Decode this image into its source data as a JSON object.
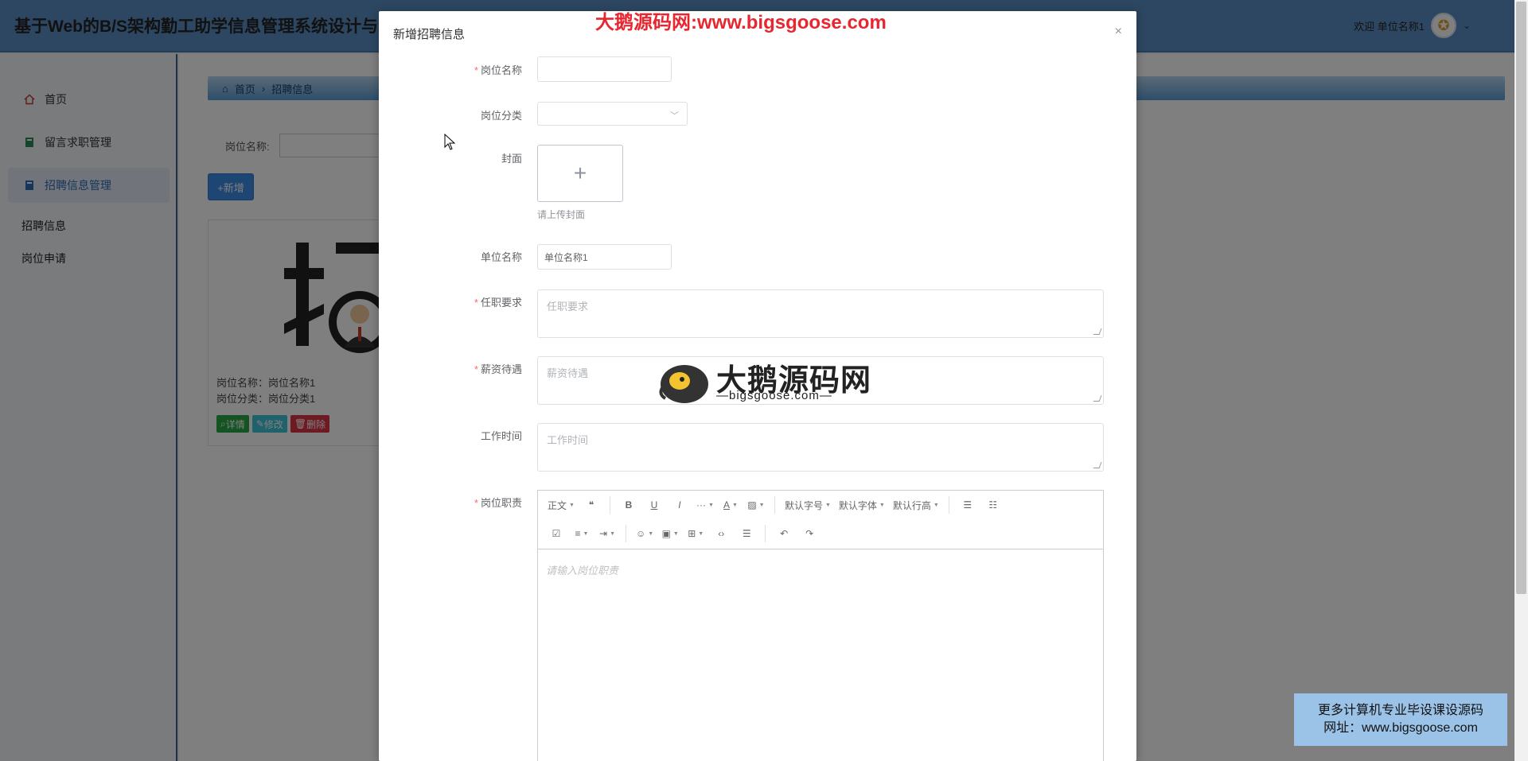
{
  "app": {
    "title": "基于Web的B/S架构勤工助学信息管理系统设计与",
    "welcome": "欢迎 单位名称1"
  },
  "sidebar": {
    "items": [
      {
        "label": "首页",
        "icon": "home-icon"
      },
      {
        "label": "留言求职管理",
        "icon": "book-icon"
      },
      {
        "label": "招聘信息管理",
        "icon": "book-icon"
      }
    ],
    "subitems": [
      "招聘信息",
      "岗位申请"
    ]
  },
  "breadcrumb": {
    "home": "首页",
    "separator": "›",
    "current": "招聘信息"
  },
  "search": {
    "label": "岗位名称:"
  },
  "add_button": "+新增",
  "card": {
    "name": "岗位名称：岗位名称1",
    "category": "岗位分类：岗位分类1",
    "buttons": {
      "detail": "详情",
      "edit": "修改",
      "delete": "删除"
    }
  },
  "dialog": {
    "title": "新增招聘信息",
    "close": "×",
    "fields": {
      "position_name": {
        "label": "岗位名称",
        "value": ""
      },
      "position_category": {
        "label": "岗位分类",
        "value": ""
      },
      "cover": {
        "label": "封面",
        "tip": "请上传封面"
      },
      "unit_name": {
        "label": "单位名称",
        "value": "单位名称1"
      },
      "requirements": {
        "label": "任职要求",
        "placeholder": "任职要求"
      },
      "salary": {
        "label": "薪资待遇",
        "placeholder": "薪资待遇"
      },
      "work_time": {
        "label": "工作时间",
        "placeholder": "工作时间"
      },
      "duties": {
        "label": "岗位职责",
        "placeholder": "请输入岗位职责"
      }
    },
    "toolbar": {
      "paragraph": "正文",
      "font_size": "默认字号",
      "font_family": "默认字体",
      "line_height": "默认行高"
    }
  },
  "watermarks": {
    "top": "大鹅源码网:www.bigsgoose.com",
    "center_cn": "大鹅源码网",
    "center_en": "—bigsgoose.com—",
    "box_line1": "更多计算机专业毕设课设源码",
    "box_line2": "网址：www.bigsgoose.com"
  },
  "colors": {
    "topbar": "#5b8fc4",
    "primary": "#3c8de6",
    "required": "#f56c6c",
    "watermark_red": "#e8262f"
  }
}
